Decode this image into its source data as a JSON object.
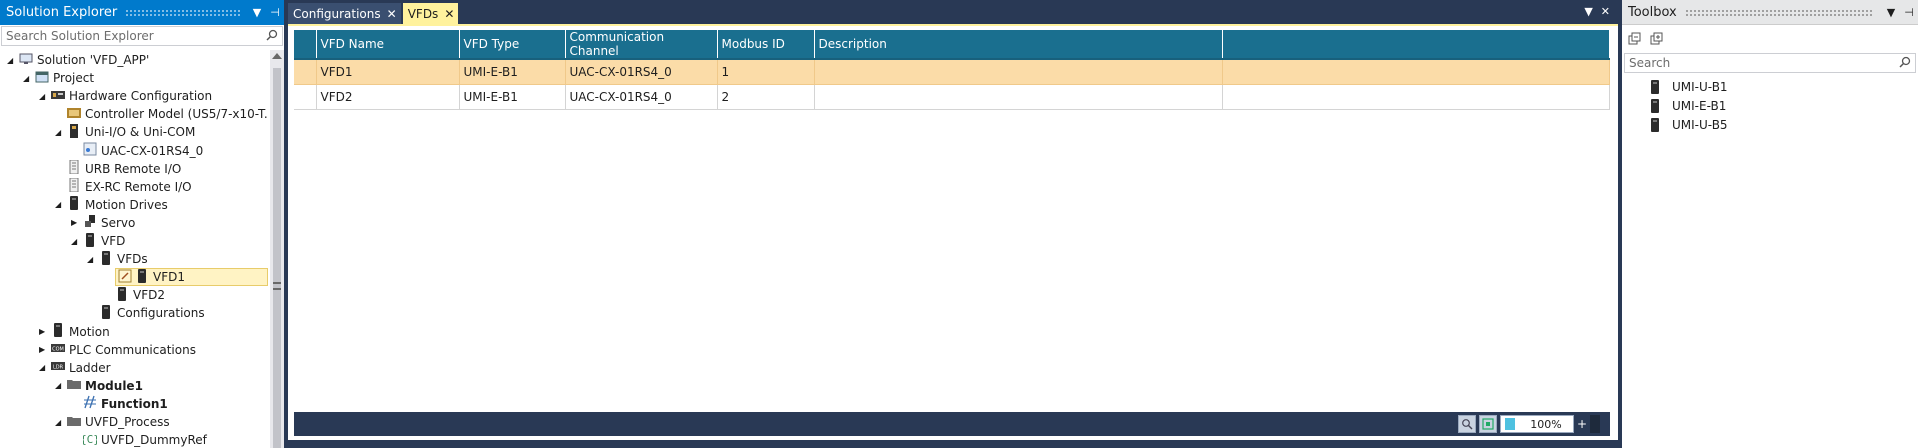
{
  "solution_explorer": {
    "title": "Solution Explorer",
    "search_placeholder": "Search Solution Explorer",
    "tree": [
      {
        "label": "Solution 'VFD_APP'",
        "depth": 0,
        "expander": "open",
        "icon": "solution-icon"
      },
      {
        "label": "Project",
        "depth": 1,
        "expander": "open",
        "icon": "project-icon"
      },
      {
        "label": "Hardware Configuration",
        "depth": 2,
        "expander": "open",
        "icon": "hardware-icon"
      },
      {
        "label": "Controller Model (US5/7-x10-T...",
        "depth": 3,
        "expander": "none",
        "icon": "controller-icon"
      },
      {
        "label": "Uni-I/O & Uni-COM",
        "depth": 3,
        "expander": "open",
        "icon": "io-module-icon"
      },
      {
        "label": "UAC-CX-01RS4_0",
        "depth": 4,
        "expander": "none",
        "icon": "com-module-icon"
      },
      {
        "label": "URB Remote I/O",
        "depth": 3,
        "expander": "none",
        "icon": "remote-io-icon"
      },
      {
        "label": "EX-RC Remote I/O",
        "depth": 3,
        "expander": "none",
        "icon": "remote-io-icon"
      },
      {
        "label": "Motion Drives",
        "depth": 3,
        "expander": "open",
        "icon": "drive-icon"
      },
      {
        "label": "Servo",
        "depth": 4,
        "expander": "closed",
        "icon": "servo-icon"
      },
      {
        "label": "VFD",
        "depth": 4,
        "expander": "open",
        "icon": "drive-icon"
      },
      {
        "label": "VFDs",
        "depth": 5,
        "expander": "open",
        "icon": "drive-icon"
      },
      {
        "label": "VFD1",
        "depth": 6,
        "expander": "none",
        "icon": "drive-icon",
        "selected": true
      },
      {
        "label": "VFD2",
        "depth": 6,
        "expander": "none",
        "icon": "drive-icon"
      },
      {
        "label": "Configurations",
        "depth": 5,
        "expander": "none",
        "icon": "drive-icon"
      },
      {
        "label": "Motion",
        "depth": 2,
        "expander": "closed",
        "icon": "drive-icon"
      },
      {
        "label": "PLC Communications",
        "depth": 2,
        "expander": "closed",
        "icon": "com-icon"
      },
      {
        "label": "Ladder",
        "depth": 2,
        "expander": "open",
        "icon": "ladder-icon"
      },
      {
        "label": "Module1",
        "depth": 3,
        "expander": "open",
        "icon": "folder-icon",
        "bold": true
      },
      {
        "label": "Function1",
        "depth": 4,
        "expander": "none",
        "icon": "function-icon",
        "bold": true
      },
      {
        "label": "UVFD_Process",
        "depth": 3,
        "expander": "open",
        "icon": "folder-icon"
      },
      {
        "label": "UVFD_DummyRef",
        "depth": 4,
        "expander": "none",
        "icon": "braces-icon"
      }
    ]
  },
  "document": {
    "tabs": [
      {
        "label": "Configurations",
        "active": false
      },
      {
        "label": "VFDs",
        "active": true
      }
    ],
    "columns": [
      "VFD Name",
      "VFD Type",
      "Communication Channel",
      "Modbus ID",
      "Description"
    ],
    "rows": [
      {
        "cells": [
          "VFD1",
          "UMI-E-B1",
          "UAC-CX-01RS4_0",
          "1",
          ""
        ],
        "selected": true
      },
      {
        "cells": [
          "VFD2",
          "UMI-E-B1",
          "UAC-CX-01RS4_0",
          "2",
          ""
        ],
        "selected": false
      }
    ],
    "zoom": "100%",
    "zoom_plus": "+"
  },
  "toolbox": {
    "title": "Toolbox",
    "search_placeholder": "Search",
    "items": [
      "UMI-U-B1",
      "UMI-E-B1",
      "UMI-U-B5"
    ]
  },
  "colors": {
    "accent": "#007acc",
    "header": "#1a6f8f",
    "selected_row": "#fbdca8",
    "active_tab": "#fff29d",
    "frame": "#293955"
  }
}
